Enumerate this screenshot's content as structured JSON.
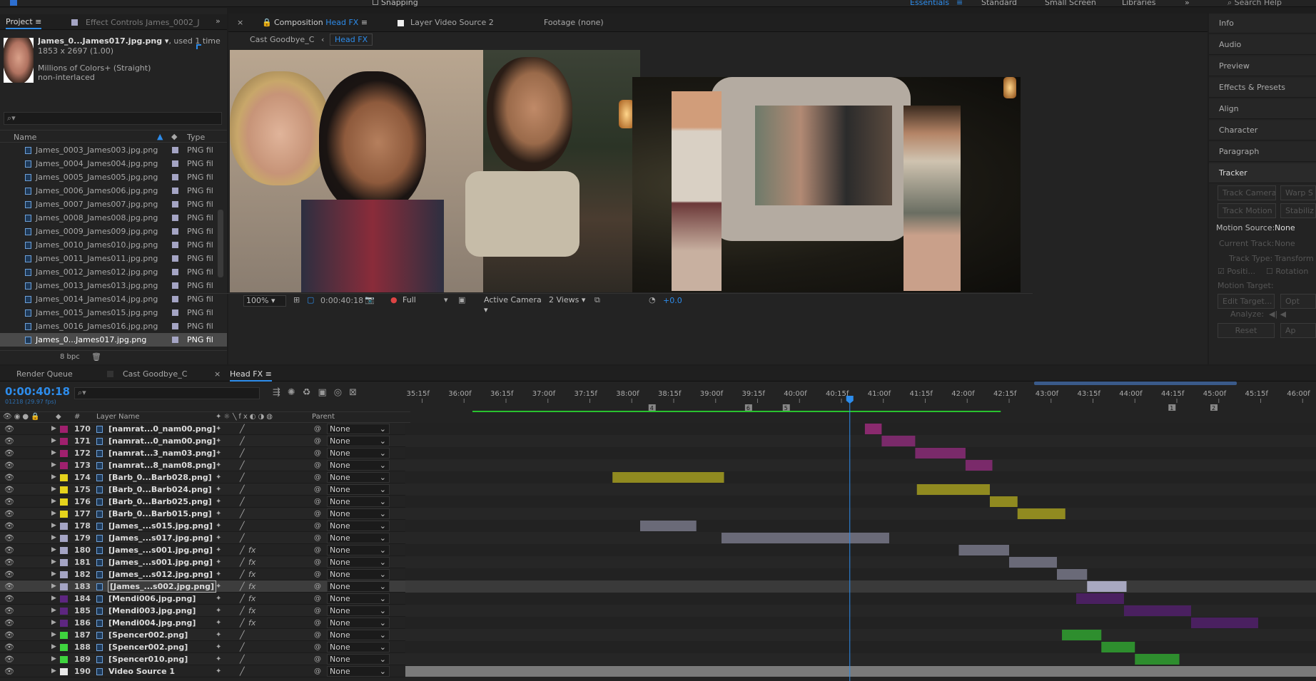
{
  "toolbar": {
    "snapping": "Snapping",
    "workspaces": [
      "Essentials",
      "Standard",
      "Small Screen",
      "Libraries"
    ],
    "search_help": "Search Help"
  },
  "project": {
    "tabs": {
      "project": "Project",
      "effect_controls": "Effect Controls James_0002_Ja"
    },
    "info": {
      "name": "James_0...James017.jpg.png",
      "used": ", used 1 time",
      "dims": "1853 x 2697 (1.00)",
      "colors": "Millions of Colors+ (Straight)",
      "interlace": "non-interlaced"
    },
    "search_placeholder": "",
    "columns": {
      "name": "Name",
      "type": "Type"
    },
    "items": [
      {
        "name": "James_0003_James003.jpg.png",
        "type": "PNG fil"
      },
      {
        "name": "James_0004_James004.jpg.png",
        "type": "PNG fil"
      },
      {
        "name": "James_0005_James005.jpg.png",
        "type": "PNG fil"
      },
      {
        "name": "James_0006_James006.jpg.png",
        "type": "PNG fil"
      },
      {
        "name": "James_0007_James007.jpg.png",
        "type": "PNG fil"
      },
      {
        "name": "James_0008_James008.jpg.png",
        "type": "PNG fil"
      },
      {
        "name": "James_0009_James009.jpg.png",
        "type": "PNG fil"
      },
      {
        "name": "James_0010_James010.jpg.png",
        "type": "PNG fil"
      },
      {
        "name": "James_0011_James011.jpg.png",
        "type": "PNG fil"
      },
      {
        "name": "James_0012_James012.jpg.png",
        "type": "PNG fil"
      },
      {
        "name": "James_0013_James013.jpg.png",
        "type": "PNG fil"
      },
      {
        "name": "James_0014_James014.jpg.png",
        "type": "PNG fil"
      },
      {
        "name": "James_0015_James015.jpg.png",
        "type": "PNG fil"
      },
      {
        "name": "James_0016_James016.jpg.png",
        "type": "PNG fil"
      },
      {
        "name": "James_0...James017.jpg.png",
        "type": "PNG fil"
      }
    ],
    "bpc": "8 bpc"
  },
  "viewer": {
    "tabs": {
      "composition_prefix": "Composition",
      "composition_name": "Head FX",
      "layer": "Layer Video Source 2",
      "footage": "Footage (none)"
    },
    "breadcrumbs": [
      "Cast Goodbye_C",
      "Head FX"
    ],
    "zoom": "100%",
    "timecode": "0:00:40:18",
    "resolution": "Full",
    "camera": "Active Camera",
    "views": "2 Views",
    "exposure": "+0.0"
  },
  "right_panels": {
    "items": [
      "Info",
      "Audio",
      "Preview",
      "Effects & Presets",
      "Align",
      "Character",
      "Paragraph",
      "Tracker"
    ],
    "tracker": {
      "track_camera": "Track Camera",
      "warp": "Warp S",
      "track_motion": "Track Motion",
      "stabilize": "Stabiliz",
      "motion_source_label": "Motion Source:",
      "motion_source": "None",
      "current_track_label": "Current Track:",
      "current_track": "None",
      "track_type_label": "Track Type:",
      "track_type": "Transform",
      "position": "Positi...",
      "rotation": "Rotation",
      "motion_target": "Motion Target:",
      "edit_target": "Edit Target...",
      "opt": "Opt",
      "analyze": "Analyze:",
      "reset": "Reset",
      "apply": "Ap"
    }
  },
  "timeline": {
    "tabs": {
      "render_queue": "Render Queue",
      "cast": "Cast Goodbye_C",
      "headfx": "Head FX"
    },
    "timecode": "0:00:40:18",
    "frames": "01218 (29.97 fps)",
    "columns": {
      "num": "#",
      "layer_name": "Layer Name",
      "parent": "Parent"
    },
    "ruler": [
      "35:15f",
      "36:00f",
      "36:15f",
      "37:00f",
      "37:15f",
      "38:00f",
      "38:15f",
      "39:00f",
      "39:15f",
      "40:00f",
      "40:15f",
      "41:00f",
      "41:15f",
      "42:00f",
      "42:15f",
      "43:00f",
      "43:15f",
      "44:00f",
      "44:15f",
      "45:00f",
      "45:15f",
      "46:00f"
    ],
    "markers": [
      "4",
      "6",
      "5",
      "1",
      "2"
    ],
    "layers": [
      {
        "num": "170",
        "name": "[namrat...0_nam00.png]",
        "color": "#a0206e",
        "fx": false,
        "start": 40.78,
        "end": 40.98,
        "bar": "#8a2a6e"
      },
      {
        "num": "171",
        "name": "[namrat...0_nam00.png]",
        "color": "#a0206e",
        "fx": false,
        "start": 40.98,
        "end": 41.38,
        "bar": "#7a2a6a"
      },
      {
        "num": "172",
        "name": "[namrat...3_nam03.png]",
        "color": "#a0206e",
        "fx": false,
        "start": 41.38,
        "end": 41.98,
        "bar": "#7a2a6a"
      },
      {
        "num": "173",
        "name": "[namrat...8_nam08.png]",
        "color": "#a0206e",
        "fx": false,
        "start": 41.98,
        "end": 42.3,
        "bar": "#7a2a6a"
      },
      {
        "num": "174",
        "name": "[Barb_0...Barb028.png]",
        "color": "#e5d31c",
        "fx": false,
        "start": 37.77,
        "end": 39.1,
        "bar": "#908a20"
      },
      {
        "num": "175",
        "name": "[Barb_0...Barb024.png]",
        "color": "#e5d31c",
        "fx": false,
        "start": 41.4,
        "end": 42.27,
        "bar": "#908a20"
      },
      {
        "num": "176",
        "name": "[Barb_0...Barb025.png]",
        "color": "#e5d31c",
        "fx": false,
        "start": 42.27,
        "end": 42.6,
        "bar": "#908a20"
      },
      {
        "num": "177",
        "name": "[Barb_0...Barb015.png]",
        "color": "#e5d31c",
        "fx": false,
        "start": 42.6,
        "end": 43.17,
        "bar": "#908a20"
      },
      {
        "num": "178",
        "name": "[James_...s015.jpg.png]",
        "color": "#a4a4c4",
        "fx": false,
        "start": 38.1,
        "end": 38.77,
        "bar": "#6a6a78"
      },
      {
        "num": "179",
        "name": "[James_...s017.jpg.png]",
        "color": "#a4a4c4",
        "fx": false,
        "start": 39.07,
        "end": 41.07,
        "bar": "#6a6a78"
      },
      {
        "num": "180",
        "name": "[James_...s001.jpg.png]",
        "color": "#a4a4c4",
        "fx": true,
        "start": 41.9,
        "end": 42.5,
        "bar": "#6a6a78"
      },
      {
        "num": "181",
        "name": "[James_...s001.jpg.png]",
        "color": "#a4a4c4",
        "fx": true,
        "start": 42.5,
        "end": 43.07,
        "bar": "#6a6a78"
      },
      {
        "num": "182",
        "name": "[James_...s012.jpg.png]",
        "color": "#a4a4c4",
        "fx": true,
        "start": 43.07,
        "end": 43.43,
        "bar": "#6a6a78"
      },
      {
        "num": "183",
        "name": "[James_...s002.jpg.png]",
        "color": "#a4a4c4",
        "fx": true,
        "start": 43.43,
        "end": 43.9,
        "bar": "#a8a8c0",
        "selected": true
      },
      {
        "num": "184",
        "name": "[Mendi006.jpg.png]",
        "color": "#5d2680",
        "fx": true,
        "start": 43.3,
        "end": 43.87,
        "bar": "#4a2060"
      },
      {
        "num": "185",
        "name": "[Mendi003.jpg.png]",
        "color": "#5d2680",
        "fx": true,
        "start": 43.87,
        "end": 44.67,
        "bar": "#4a2060"
      },
      {
        "num": "186",
        "name": "[Mendi004.jpg.png]",
        "color": "#5d2680",
        "fx": true,
        "start": 44.67,
        "end": 45.47,
        "bar": "#4a2060"
      },
      {
        "num": "187",
        "name": "[Spencer002.png]",
        "color": "#3ed43e",
        "fx": false,
        "start": 43.13,
        "end": 43.6,
        "bar": "#2e8e2e"
      },
      {
        "num": "188",
        "name": "[Spencer002.png]",
        "color": "#3ed43e",
        "fx": false,
        "start": 43.6,
        "end": 44.0,
        "bar": "#2e8e2e"
      },
      {
        "num": "189",
        "name": "[Spencer010.png]",
        "color": "#3ed43e",
        "fx": false,
        "start": 44.0,
        "end": 44.53,
        "bar": "#2e8e2e"
      },
      {
        "num": "190",
        "name": "Video Source 1",
        "color": "#e8e8e8",
        "fx": false,
        "start": 35.0,
        "end": 46.3,
        "bar": "#7a7a7a",
        "plain": true
      }
    ],
    "parent_value": "None"
  }
}
